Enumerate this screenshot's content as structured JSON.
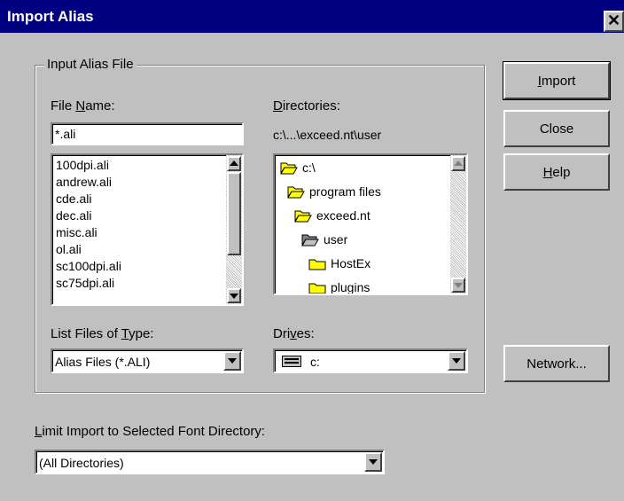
{
  "window": {
    "title": "Import Alias",
    "close_glyph": "✕"
  },
  "group": {
    "legend": "Input Alias File"
  },
  "file_name": {
    "label_pre": "File ",
    "label_u": "N",
    "label_post": "ame:",
    "value": "*.ali",
    "files": [
      "100dpi.ali",
      "andrew.ali",
      "cde.ali",
      "dec.ali",
      "misc.ali",
      "ol.ali",
      "sc100dpi.ali",
      "sc75dpi.ali"
    ]
  },
  "directories": {
    "label_pre": "",
    "label_u": "D",
    "label_post": "irectories:",
    "current_path": "c:\\...\\exceed.nt\\user",
    "items": [
      {
        "name": "c:\\",
        "icon": "open-folder-icon"
      },
      {
        "name": "program files",
        "icon": "open-folder-icon"
      },
      {
        "name": "exceed.nt",
        "icon": "open-folder-icon"
      },
      {
        "name": "user",
        "icon": "open-folder-icon"
      },
      {
        "name": "HostEx",
        "icon": "folder-icon"
      },
      {
        "name": "plugins",
        "icon": "folder-icon"
      }
    ]
  },
  "file_type": {
    "label_pre": "List Files of ",
    "label_u": "T",
    "label_post": "ype:",
    "selected": "Alias Files (*.ALI)"
  },
  "drives": {
    "label_pre": "Dri",
    "label_u": "v",
    "label_post": "es:",
    "selected": "c:",
    "icon": "drive-icon"
  },
  "buttons": {
    "import_u": "I",
    "import_post": "mport",
    "close": "Close",
    "help_u": "H",
    "help_post": "elp",
    "network": "Network..."
  },
  "limit": {
    "label_pre": "",
    "label_u": "L",
    "label_post": "imit Import to Selected Font Directory:",
    "selected": "(All Directories)"
  },
  "colors": {
    "titlebar": "#000080",
    "face": "#c0c0c0",
    "folder": "#ffff00"
  }
}
